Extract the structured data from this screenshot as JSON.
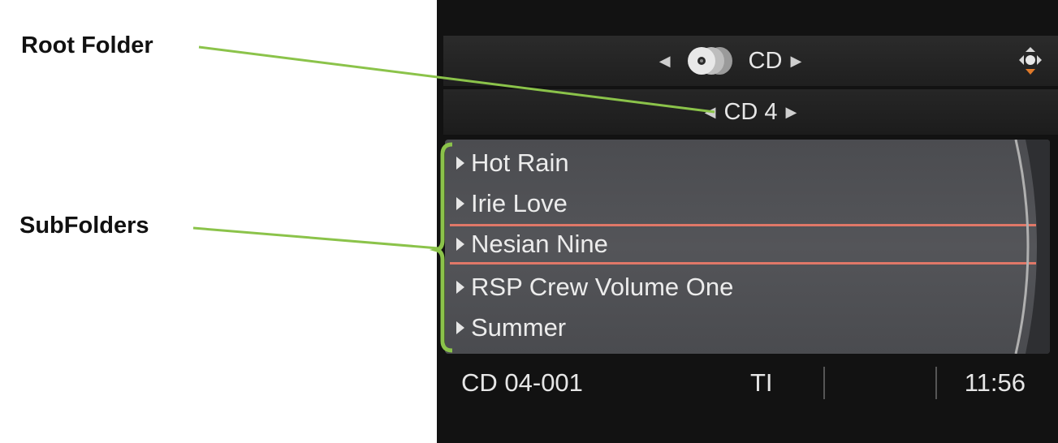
{
  "callouts": {
    "root_folder": "Root Folder",
    "subfolders": "SubFolders"
  },
  "header": {
    "source_label": "CD",
    "source_icon": "disc-stack-icon",
    "nav_icon": "joystick-nav-icon"
  },
  "folder": {
    "current": "CD 4"
  },
  "list": {
    "items": [
      {
        "label": "Hot Rain"
      },
      {
        "label": "Irie Love"
      },
      {
        "label": "Nesian Nine"
      },
      {
        "label": "RSP Crew Volume One"
      },
      {
        "label": "Summer"
      }
    ],
    "selected_index": 2
  },
  "status": {
    "track": "CD 04-001",
    "ti": "TI",
    "time": "11:56"
  },
  "colors": {
    "accent_line": "#8bc34a",
    "selection": "#e07868",
    "list_bg": "#4f5054"
  }
}
